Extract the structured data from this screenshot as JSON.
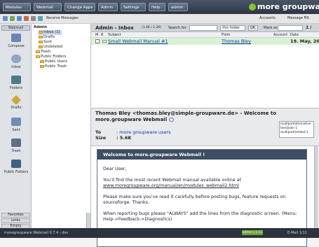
{
  "topbar": {
    "buttons": [
      "Modules",
      "Webmail",
      "Change Apps",
      "Admin",
      "Settings",
      "Help",
      "admin"
    ],
    "brand": "more groupwa",
    "accent_color": "#86c43a"
  },
  "toolbar": {
    "icons": [
      "new-icon",
      "reply-icon",
      "forward-icon",
      "delete-icon",
      "print-icon",
      "refresh-icon"
    ],
    "receive_label": "Receive Messages",
    "accounts_label": "Accounts",
    "message_filter_label": "Message Filt"
  },
  "sidebar": {
    "tab_label": "Webmail",
    "items": [
      {
        "label": "Compose",
        "icon": "compose-icon"
      },
      {
        "label": "Inbox",
        "icon": "inbox-icon"
      },
      {
        "label": "Folders",
        "icon": "folders-icon"
      },
      {
        "label": "Drafts",
        "icon": "drafts-icon"
      },
      {
        "label": "Sent",
        "icon": "sent-icon"
      },
      {
        "label": "Trash",
        "icon": "trash-icon"
      },
      {
        "label": "Public Folders",
        "icon": "public-folders-icon"
      }
    ],
    "bottom": [
      "Favorites",
      "Links",
      "Empty"
    ]
  },
  "tree": {
    "items": [
      "Admin",
      "Inbox (1)",
      "Drafts",
      "Sent",
      "Undeleted",
      "Trash",
      "Public Folders",
      "Public Users",
      "Public Trash"
    ]
  },
  "main": {
    "title": "Admin - Inbox",
    "title_note": "(1.4K / 1.2K)",
    "search_label": "Search for",
    "folder_select": "this folder",
    "ok_label": "OK",
    "mark_label": "Mark as",
    "page_indicator": "1 /",
    "columns": [
      "M",
      "R",
      "Subject",
      "From",
      "Account",
      "Date"
    ],
    "messages": [
      {
        "subject": "Small Webmail Manual #1",
        "from": "Thomas Bley",
        "date": "19. May, 200"
      }
    ]
  },
  "preview": {
    "from_line": "Thomas Bley <thomas.bley@simple-groupware.de> - Welcome to more.groupware Webmail",
    "to_label": "To",
    "to_value": ": more groupware users",
    "size_label": "Size",
    "size_value": ": 5.6K",
    "attachments": [
      "multipart/alternative",
      "text/plain 1",
      "multipart/related 2"
    ]
  },
  "body": {
    "title": "Welcome to more.groupware Webmail !",
    "greeting": "Dear User,",
    "p1": "You'll find the most recent Webmail manual available online at",
    "p1_link": "www.moregroupware.org/manual/en/modules_webmail2.html",
    "p2": "Please make sure you've read it carefully before posting bugs, feature requests on sourceforge. Thanks.",
    "p3": "When reporting bugs please \"ALWAYS\" add the lines from the diagnostic screen. (Menu: Help->Feedback->Diagnostics)"
  },
  "statusbar": {
    "left": "moregroupware Webmail 0.7.4 - dev",
    "green": "admin | 1:11",
    "right": "E-Mail 1/11"
  }
}
